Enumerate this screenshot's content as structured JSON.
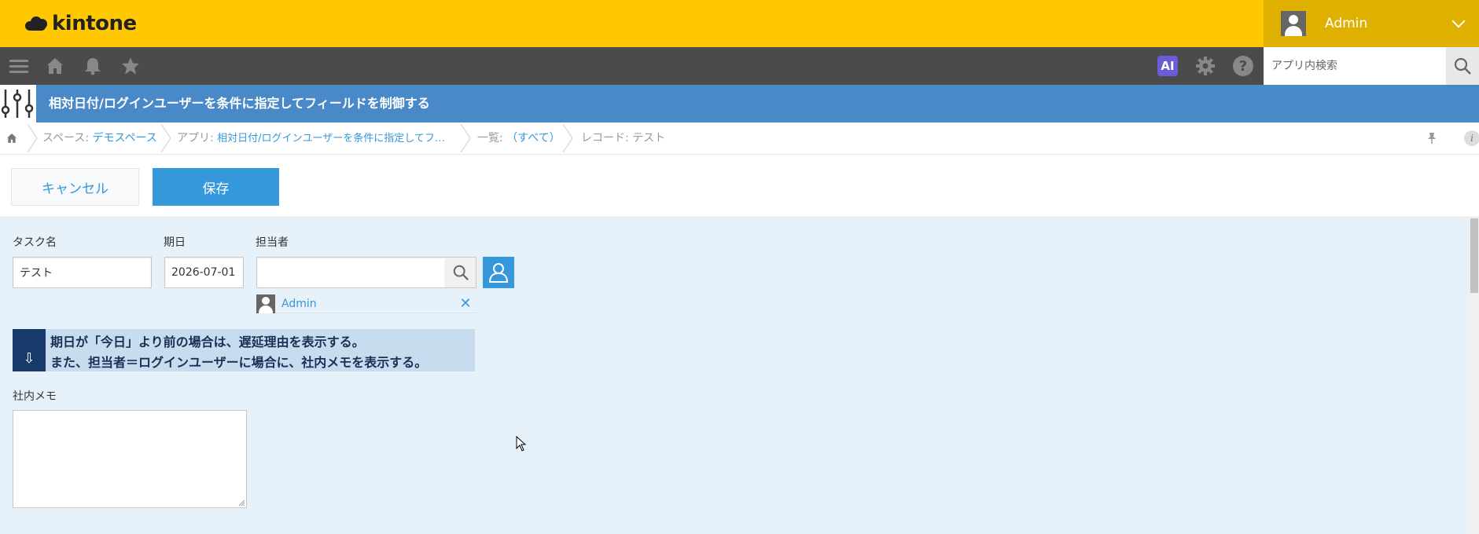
{
  "header": {
    "logo_text": "kintone",
    "user_name": "Admin"
  },
  "navbar": {
    "ai_label": "AI",
    "help_label": "?",
    "search_placeholder": "アプリ内検索"
  },
  "app": {
    "title": "相対日付/ログインユーザーを条件に指定してフィールドを制御する"
  },
  "breadcrumb": {
    "space_label": "スペース: ",
    "space_link": "デモスペース",
    "app_label": "アプリ: ",
    "app_link": "相対日付/ログインユーザーを条件に指定してフ…",
    "view_label": "一覧: ",
    "view_link": "（すべて）",
    "record_label": "レコード: テスト"
  },
  "toolbar": {
    "cancel_label": "キャンセル",
    "save_label": "保存"
  },
  "form": {
    "task_label": "タスク名",
    "task_value": "テスト",
    "due_label": "期日",
    "due_value": "2026-07-01",
    "assignee_label": "担当者",
    "assignee_value": "",
    "selected_user": "Admin",
    "notice_line1": "期日が「今日」より前の場合は、遅延理由を表示する。",
    "notice_line2": "また、担当者＝ログインユーザーに場合に、社内メモを表示する。",
    "notice_icon": "⇩",
    "memo_label": "社内メモ",
    "memo_value": ""
  },
  "colors": {
    "header_yellow": "#ffc800",
    "navbar_dark": "#4b4b4b",
    "appbar_blue": "#4a89c8",
    "accent_blue": "#3498db",
    "form_bg": "#e6f1fa"
  }
}
